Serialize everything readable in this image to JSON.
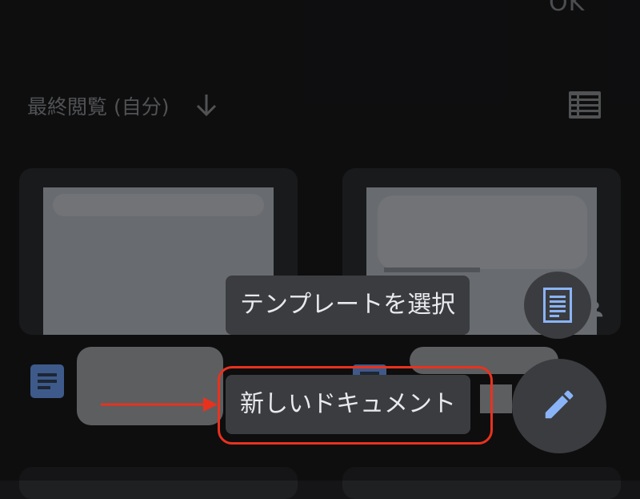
{
  "header": {
    "ok_label": "OK",
    "sort_label": "最終閲覧 (自分)",
    "sort_icon": "arrow-down-icon",
    "view_toggle_icon": "list-view-icon"
  },
  "cards": [
    {
      "icon": "docs-document-icon"
    },
    {
      "icon": "docs-document-icon",
      "shared_icon": "person-icon"
    }
  ],
  "speed_dial": {
    "template_label": "テンプレートを選択",
    "template_icon": "document-template-icon",
    "new_doc_label": "新しいドキュメント",
    "new_doc_icon": "pencil-icon"
  },
  "colors": {
    "background": "#151517",
    "surface": "#3b3c3f",
    "accent": "#8ab4f8",
    "annotation": "#e8321e"
  }
}
